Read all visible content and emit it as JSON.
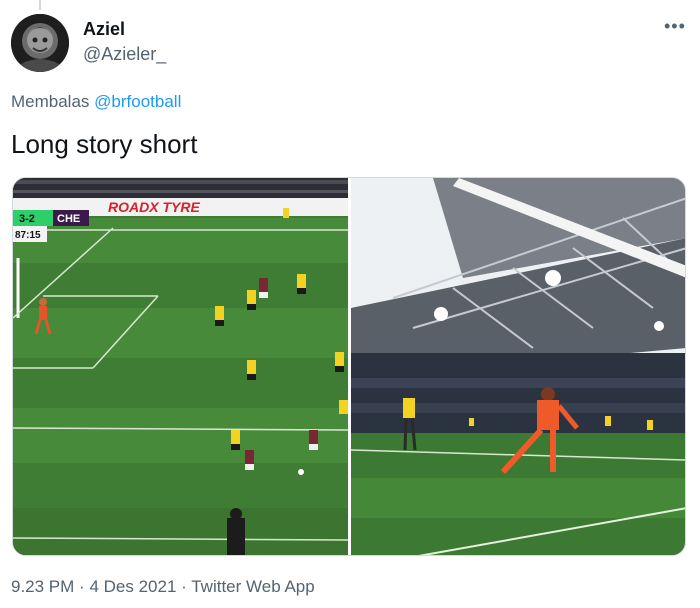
{
  "author": {
    "name": "Aziel",
    "handle": "@Azieler_"
  },
  "reply": {
    "prefix": "Membalas",
    "mention": "@brfootball"
  },
  "tweet": {
    "text": "Long story short"
  },
  "media": {
    "left_panel": {
      "score": "3-2",
      "team": "CHE",
      "clock": "87:15",
      "board_text": "ROADX TYRE"
    }
  },
  "meta": {
    "time": "9.23 PM",
    "date": "4 Des 2021",
    "source": "Twitter Web App",
    "separator": "·"
  },
  "icons": {
    "more": "more-horizontal-icon"
  }
}
